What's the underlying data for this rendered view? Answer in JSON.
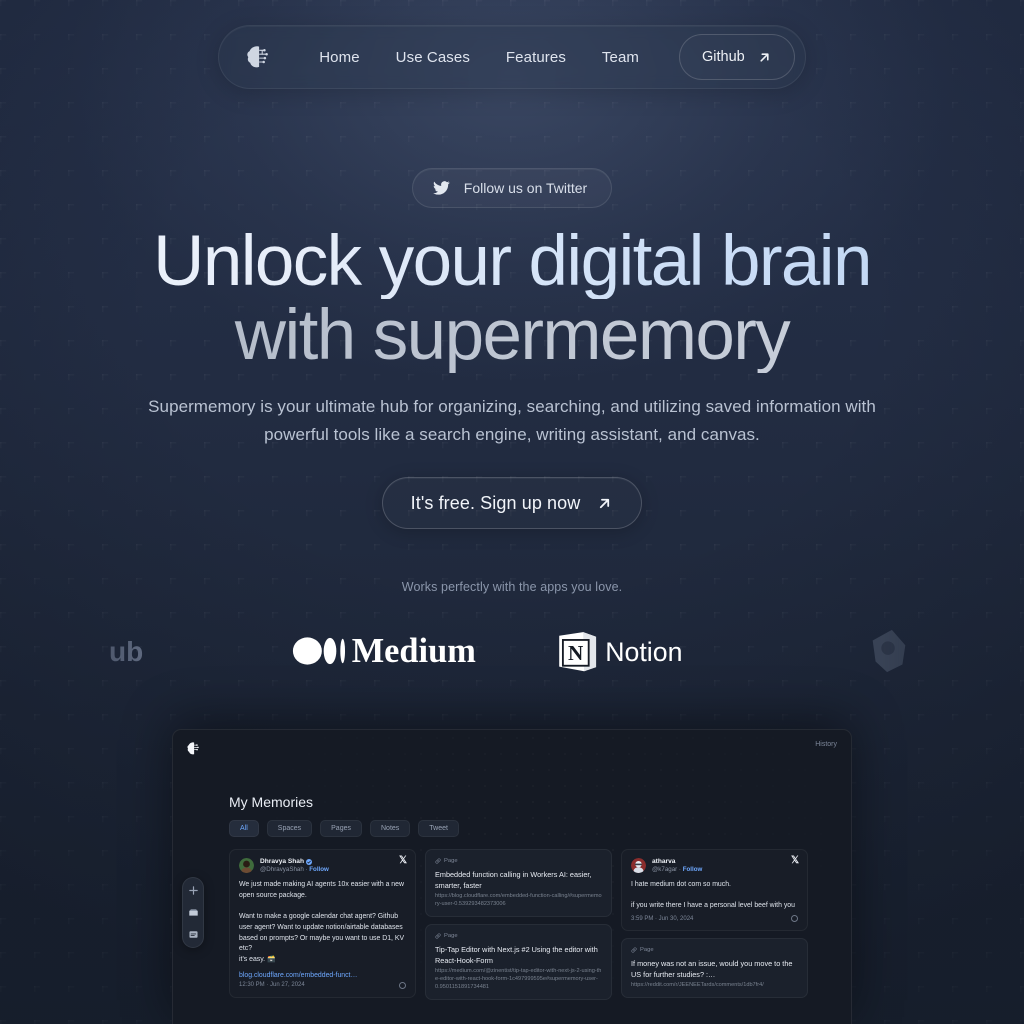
{
  "nav": {
    "logo_icon": "brain-circuit-logo",
    "links": [
      {
        "label": "Home"
      },
      {
        "label": "Use Cases"
      },
      {
        "label": "Features"
      },
      {
        "label": "Team"
      }
    ],
    "github_label": "Github",
    "github_icon": "arrow-up-right-icon"
  },
  "hero": {
    "twitter_pill_label": "Follow us on Twitter",
    "twitter_icon": "twitter-bird-icon",
    "headline_line1": "Unlock your digital brain",
    "headline_line2": "with supermemory",
    "subtitle": "Supermemory is your ultimate hub for organizing, searching, and utilizing saved information with powerful tools like a search engine, writing assistant, and canvas.",
    "cta_label": "It's free. Sign up now",
    "cta_icon": "arrow-up-right-icon",
    "works_note": "Works perfectly with the apps you love."
  },
  "marquee": {
    "logos": [
      {
        "name": "github-logo",
        "label": "ub"
      },
      {
        "name": "medium-logo",
        "label": "Medium"
      },
      {
        "name": "notion-logo",
        "label": "Notion"
      },
      {
        "name": "obsidian-logo",
        "label": ""
      }
    ]
  },
  "app_preview": {
    "logo_icon": "brain-circuit-logo",
    "history_label": "History",
    "title": "My Memories",
    "chips": [
      {
        "label": "All",
        "active": true
      },
      {
        "label": "Spaces",
        "active": false
      },
      {
        "label": "Pages",
        "active": false
      },
      {
        "label": "Notes",
        "active": false
      },
      {
        "label": "Tweet",
        "active": false
      }
    ],
    "toolbar": {
      "items": [
        {
          "name": "add-icon"
        },
        {
          "name": "folder-icon"
        },
        {
          "name": "note-icon"
        }
      ]
    },
    "columns": [
      {
        "cards": [
          {
            "type": "tweet",
            "author": "Dhravya Shah",
            "verified": true,
            "handle": "@DhravyaShah",
            "follow": "Follow",
            "body": "We just made making AI agents 10x easier with a new open source package.\n\nWant to make a google calendar chat agent? Github user agent? Want to update notion/airtable databases based on prompts? Or maybe you want to use D1, KV etc?\nit's easy. 🗃️",
            "link": "blog.cloudflare.com/embedded-funct…",
            "time": "12:30 PM · Jun 27, 2024"
          }
        ]
      },
      {
        "cards": [
          {
            "type": "page",
            "tag": "Page",
            "title": "Embedded function calling in Workers AI: easier, smarter, faster",
            "url": "https://blog.cloudflare.com/embedded-function-calling/#supermemory-user-0.539293482373006"
          },
          {
            "type": "page",
            "tag": "Page",
            "title": "Tip-Tap Editor with Next.js #2 Using the editor with React-Hook-Form",
            "url": "https://medium.com/@zinentist/tip-tap-editor-with-next-js-2-using-the-editor-with-react-hook-form-1c497999595e#supermemory-user-0.9501151891734481"
          }
        ]
      },
      {
        "cards": [
          {
            "type": "tweet",
            "author": "atharva",
            "verified": false,
            "handle": "@k7agar",
            "follow": "Follow",
            "body": "I hate medium dot com so much.\n\nif you write there I have a personal level beef with you",
            "link": "",
            "time": "3:59 PM · Jun 30, 2024"
          },
          {
            "type": "page",
            "tag": "Page",
            "title": "If money was not an issue, would you move to the US for further studies? :…",
            "url": "https://reddit.com/r/JEENEETards/comments/1db7fr4/"
          }
        ]
      }
    ]
  },
  "colors": {
    "background": "#222c42",
    "accent_blue": "#6ea8fe",
    "card_bg": "#1b212c",
    "panel_bg": "#151a24",
    "text_primary": "#eef1f6",
    "text_muted": "#8b96ab"
  }
}
